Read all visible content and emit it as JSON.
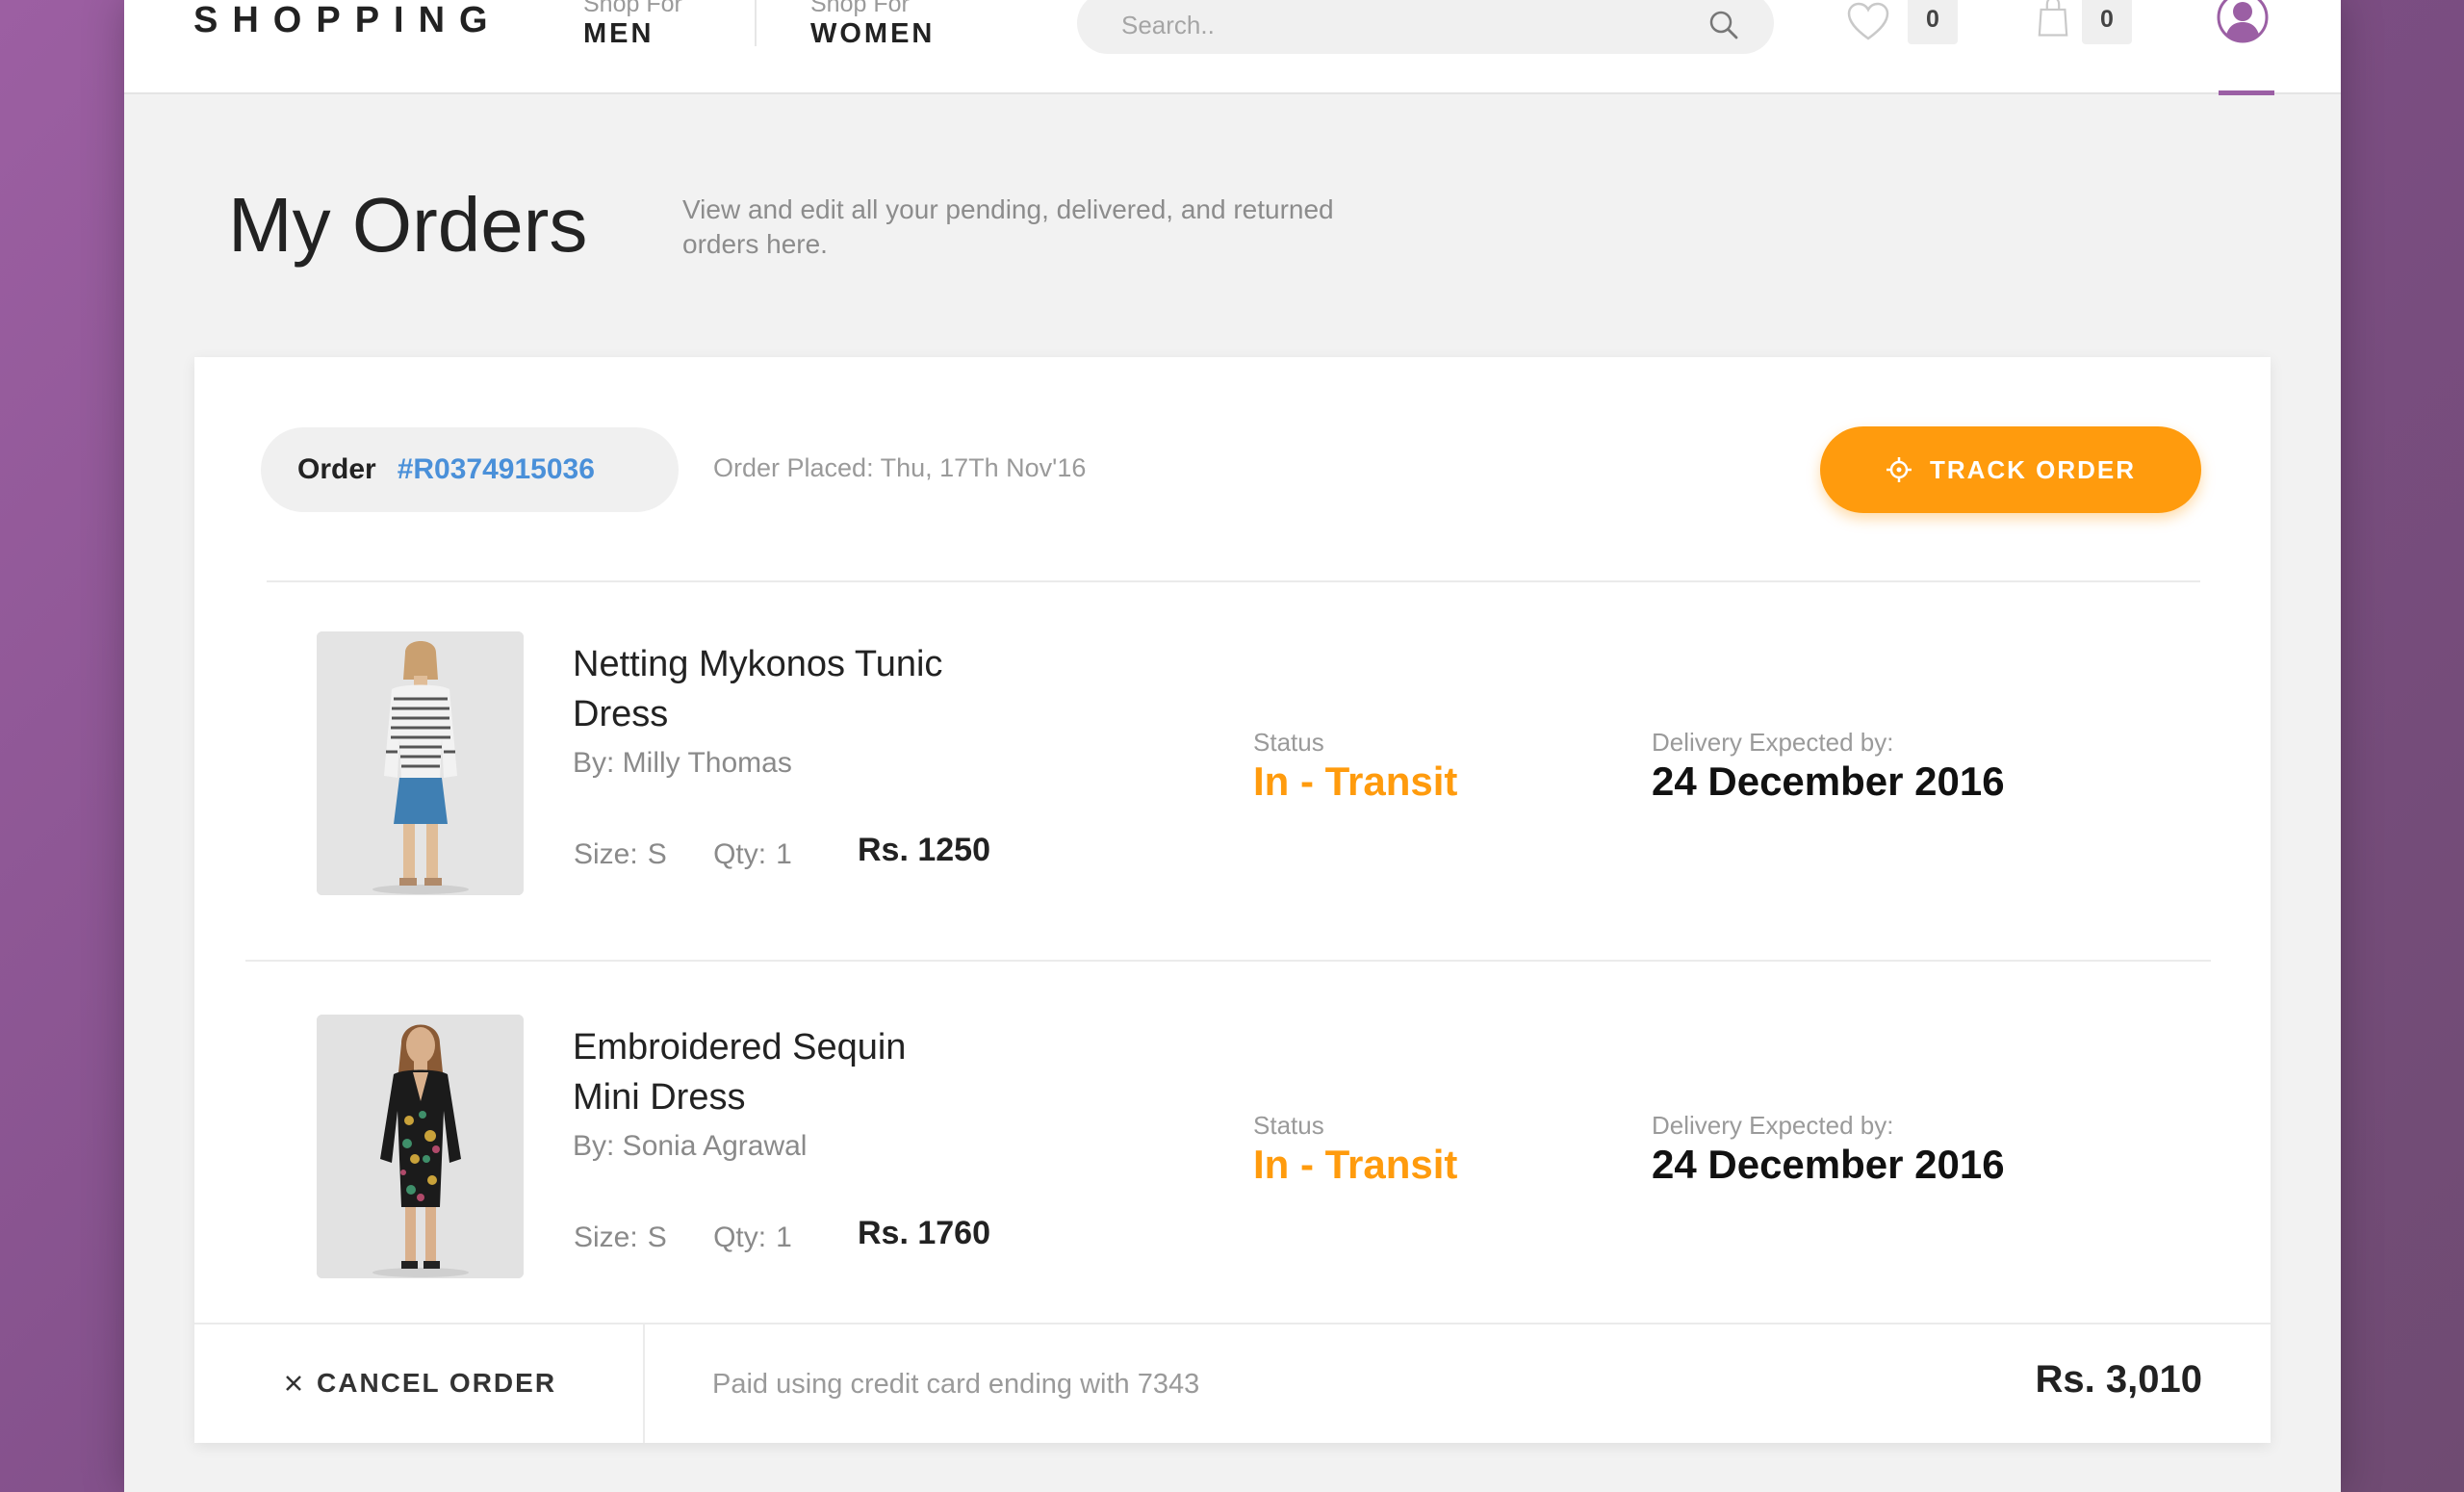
{
  "header": {
    "logo": "SHOPPING",
    "nav": [
      {
        "small": "Shop For",
        "label": "MEN"
      },
      {
        "small": "Shop For",
        "label": "WOMEN"
      }
    ],
    "search_placeholder": "Search..",
    "wishlist_count": "0",
    "cart_count": "0"
  },
  "page": {
    "title": "My Orders",
    "subtitle": "View and edit all your pending, delivered, and returned orders here."
  },
  "order": {
    "label": "Order",
    "number": "#R0374915036",
    "placed": "Order Placed: Thu, 17Th Nov'16",
    "track_label": "TRACK ORDER",
    "items": [
      {
        "name": "Netting Mykonos Tunic Dress",
        "by": "By: Milly Thomas",
        "size_label": "Size:",
        "size": "S",
        "qty_label": "Qty:",
        "qty": "1",
        "price": "Rs. 1250",
        "status_label": "Status",
        "status": "In - Transit",
        "delivery_label": "Delivery Expected by:",
        "delivery_date": "24 December 2016"
      },
      {
        "name": "Embroidered Sequin Mini Dress",
        "by": "By: Sonia Agrawal",
        "size_label": "Size:",
        "size": "S",
        "qty_label": "Qty:",
        "qty": "1",
        "price": "Rs. 1760",
        "status_label": "Status",
        "status": "In - Transit",
        "delivery_label": "Delivery Expected by:",
        "delivery_date": "24 December 2016"
      }
    ],
    "cancel_label": "CANCEL ORDER",
    "payment": "Paid using credit card ending with 7343",
    "total": "Rs. 3,010"
  },
  "colors": {
    "accent_orange": "#ff9b0d",
    "order_number_blue": "#4a90d9",
    "brand_purple": "#9b5fa4"
  },
  "icons": [
    "search-icon",
    "heart-icon",
    "shopping-bag-icon",
    "user-avatar-icon",
    "crosshair-icon",
    "close-icon"
  ]
}
